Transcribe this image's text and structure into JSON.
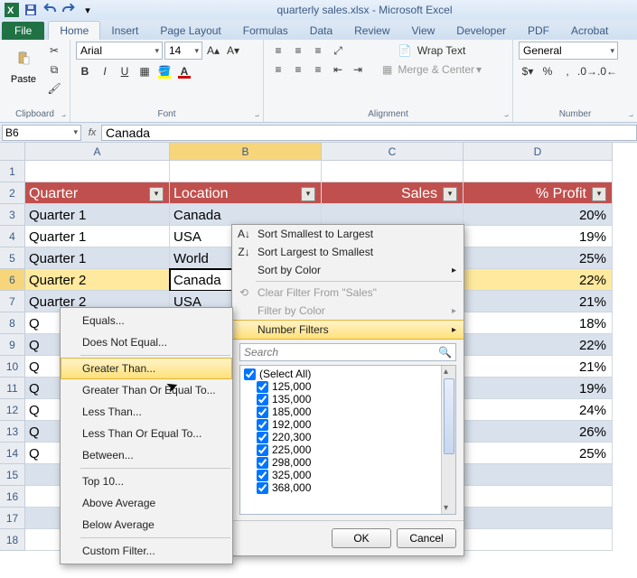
{
  "window": {
    "title": "quarterly sales.xlsx - Microsoft Excel"
  },
  "tabs": {
    "file": "File",
    "home": "Home",
    "insert": "Insert",
    "layout": "Page Layout",
    "formulas": "Formulas",
    "data": "Data",
    "review": "Review",
    "view": "View",
    "developer": "Developer",
    "pdf": "PDF",
    "acrobat": "Acrobat"
  },
  "ribbon": {
    "clipboard": {
      "label": "Clipboard",
      "paste": "Paste"
    },
    "font": {
      "label": "Font",
      "name": "Arial",
      "size": "14"
    },
    "alignment": {
      "label": "Alignment",
      "wrap": "Wrap Text",
      "merge": "Merge & Center"
    },
    "number": {
      "label": "Number",
      "format": "General"
    }
  },
  "namebox": "B6",
  "formula": "Canada",
  "columns": [
    "A",
    "B",
    "C",
    "D"
  ],
  "headers": {
    "A": "Quarter",
    "B": "Location",
    "C": "Sales",
    "D": "% Profit"
  },
  "rows": [
    {
      "n": "1"
    },
    {
      "n": "2",
      "hdr": true
    },
    {
      "n": "3",
      "A": "Quarter 1",
      "B": "Canada",
      "D": "20%"
    },
    {
      "n": "4",
      "A": "Quarter 1",
      "B": "USA",
      "D": "19%"
    },
    {
      "n": "5",
      "A": "Quarter 1",
      "B": "World",
      "D": "25%"
    },
    {
      "n": "6",
      "A": "Quarter 2",
      "B": "Canada",
      "D": "22%",
      "active": true
    },
    {
      "n": "7",
      "A": "Quarter 2",
      "B": "USA",
      "D": "21%"
    },
    {
      "n": "8",
      "A": "Q",
      "D": "18%"
    },
    {
      "n": "9",
      "A": "Q",
      "D": "22%"
    },
    {
      "n": "10",
      "A": "Q",
      "D": "21%"
    },
    {
      "n": "11",
      "A": "Q",
      "D": "19%"
    },
    {
      "n": "12",
      "A": "Q",
      "D": "24%"
    },
    {
      "n": "13",
      "A": "Q",
      "D": "26%"
    },
    {
      "n": "14",
      "A": "Q",
      "D": "25%"
    },
    {
      "n": "15"
    },
    {
      "n": "16"
    },
    {
      "n": "17"
    },
    {
      "n": "18"
    }
  ],
  "filter": {
    "sort_asc": "Sort Smallest to Largest",
    "sort_desc": "Sort Largest to Smallest",
    "sort_color": "Sort by Color",
    "clear": "Clear Filter From \"Sales\"",
    "filter_color": "Filter by Color",
    "number_filters": "Number Filters",
    "search_placeholder": "Search",
    "select_all": "(Select All)",
    "values": [
      "125,000",
      "135,000",
      "185,000",
      "192,000",
      "220,300",
      "225,000",
      "298,000",
      "325,000",
      "368,000"
    ],
    "ok": "OK",
    "cancel": "Cancel"
  },
  "nfilters": {
    "equals": "Equals...",
    "not": "Does Not Equal...",
    "gt": "Greater Than...",
    "gte": "Greater Than Or Equal To...",
    "lt": "Less Than...",
    "lte": "Less Than Or Equal To...",
    "between": "Between...",
    "top10": "Top 10...",
    "above": "Above Average",
    "below": "Below Average",
    "custom": "Custom Filter..."
  }
}
